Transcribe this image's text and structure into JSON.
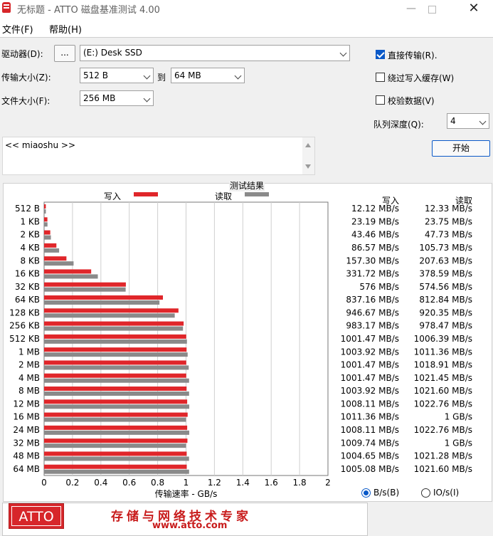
{
  "window": {
    "title": "无标题 - ATTO 磁盘基准测试 4.00"
  },
  "menu": {
    "file": "文件(F)",
    "help": "帮助(H)"
  },
  "controls": {
    "drive_label": "驱动器(D):",
    "browse_label": "...",
    "drive_value": "(E:) Desk SSD",
    "transfer_label": "传输大小(Z):",
    "transfer_from": "512 B",
    "to_label": "到",
    "transfer_to": "64 MB",
    "filesize_label": "文件大小(F):",
    "filesize_value": "256 MB",
    "direct_io": {
      "label": "直接传输(R).",
      "checked": true
    },
    "bypass_write_cache": {
      "label": "绕过写入缓存(W)",
      "checked": false
    },
    "verify_data": {
      "label": "校验数据(V)",
      "checked": false
    },
    "queue_depth_label": "队列深度(Q):",
    "queue_depth_value": "4",
    "start_label": "开始"
  },
  "description": {
    "text": "<< miaoshu >>"
  },
  "results": {
    "title": "测试结果",
    "col_write": "写入",
    "col_read": "读取"
  },
  "units": {
    "bytes_label": "B/s(B)",
    "io_label": "IO/s(I)",
    "selected": "bytes"
  },
  "banner": {
    "logo_text": "ATTO",
    "slogan": "存储与网络技术专家",
    "url": "www.atto.com"
  },
  "chart_data": {
    "type": "bar",
    "orientation": "horizontal",
    "xlabel": "传输速率 - GB/s",
    "xlim": [
      0,
      2
    ],
    "xticks": [
      "0",
      "0.2",
      "0.4",
      "0.6",
      "0.8",
      "1",
      "1.2",
      "1.4",
      "1.6",
      "1.8",
      "2"
    ],
    "grid": true,
    "legend": "top",
    "colors": {
      "write": "#e0262a",
      "read": "#8a8a8a"
    },
    "categories": [
      "512 B",
      "1 KB",
      "2 KB",
      "4 KB",
      "8 KB",
      "16 KB",
      "32 KB",
      "64 KB",
      "128 KB",
      "256 KB",
      "512 KB",
      "1 MB",
      "2 MB",
      "4 MB",
      "8 MB",
      "12 MB",
      "16 MB",
      "24 MB",
      "32 MB",
      "48 MB",
      "64 MB"
    ],
    "series": [
      {
        "name": "写入",
        "values": [
          0.01212,
          0.02319,
          0.04346,
          0.08657,
          0.1573,
          0.33172,
          0.576,
          0.83716,
          0.94667,
          0.98317,
          1.00147,
          1.00392,
          1.00147,
          1.00147,
          1.00392,
          1.00811,
          1.01136,
          1.00811,
          1.00974,
          1.00465,
          1.00508
        ],
        "labels": [
          "12.12 MB/s",
          "23.19 MB/s",
          "43.46 MB/s",
          "86.57 MB/s",
          "157.30 MB/s",
          "331.72 MB/s",
          "576 MB/s",
          "837.16 MB/s",
          "946.67 MB/s",
          "983.17 MB/s",
          "1001.47 MB/s",
          "1003.92 MB/s",
          "1001.47 MB/s",
          "1001.47 MB/s",
          "1003.92 MB/s",
          "1008.11 MB/s",
          "1011.36 MB/s",
          "1008.11 MB/s",
          "1009.74 MB/s",
          "1004.65 MB/s",
          "1005.08 MB/s"
        ]
      },
      {
        "name": "读取",
        "values": [
          0.01233,
          0.02375,
          0.04773,
          0.10573,
          0.20763,
          0.37859,
          0.57456,
          0.81284,
          0.92035,
          0.97847,
          1.00639,
          1.01136,
          1.01891,
          1.02145,
          1.0216,
          1.02276,
          1.0,
          1.02276,
          1.0,
          1.02128,
          1.0216
        ],
        "labels": [
          "12.33 MB/s",
          "23.75 MB/s",
          "47.73 MB/s",
          "105.73 MB/s",
          "207.63 MB/s",
          "378.59 MB/s",
          "574.56 MB/s",
          "812.84 MB/s",
          "920.35 MB/s",
          "978.47 MB/s",
          "1006.39 MB/s",
          "1011.36 MB/s",
          "1018.91 MB/s",
          "1021.45 MB/s",
          "1021.60 MB/s",
          "1022.76 MB/s",
          "1 GB/s",
          "1022.76 MB/s",
          "1 GB/s",
          "1021.28 MB/s",
          "1021.60 MB/s"
        ]
      }
    ]
  }
}
